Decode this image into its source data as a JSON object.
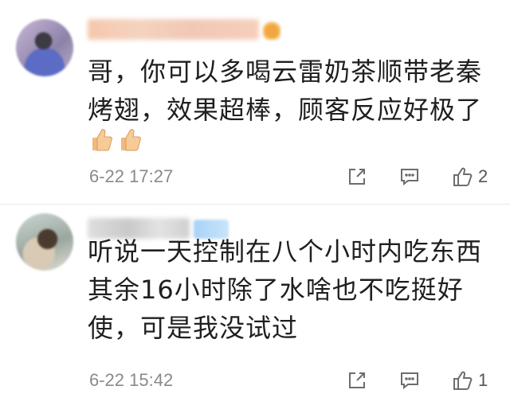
{
  "comments": [
    {
      "lines": [
        "哥，你可以多喝云雷奶茶顺带老秦",
        "烤翅，效果超棒，顾客反应好极了"
      ],
      "emoji": [
        "thumbs-up",
        "thumbs-up"
      ],
      "timestamp": "6-22 17:27",
      "likes": "2"
    },
    {
      "lines": [
        "听说一天控制在八个小时内吃东西",
        "其余16小时除了水啥也不吃挺好",
        "使，可是我没试过"
      ],
      "timestamp": "6-22 15:42",
      "likes": "1"
    }
  ],
  "icons": {
    "share": "share-icon",
    "reply": "reply-icon",
    "like": "thumbs-up-icon"
  },
  "colors": {
    "text": "#1f1f1f",
    "meta": "#8a8a8a",
    "icon": "#6d6d6d",
    "divider": "#e9e9e9"
  }
}
